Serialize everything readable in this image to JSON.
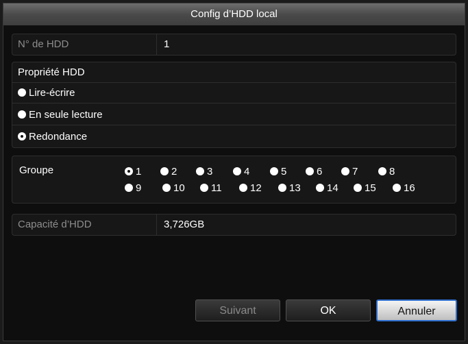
{
  "dialog": {
    "title": "Config d’HDD local"
  },
  "hdd_no": {
    "label": "N° de HDD",
    "value": "1"
  },
  "property": {
    "heading": "Propriété HDD",
    "options": [
      {
        "label": "Lire-écrire",
        "selected": false
      },
      {
        "label": "En seule lecture",
        "selected": false
      },
      {
        "label": "Redondance",
        "selected": true
      }
    ]
  },
  "group": {
    "label": "Groupe",
    "options": [
      "1",
      "2",
      "3",
      "4",
      "5",
      "6",
      "7",
      "8",
      "9",
      "10",
      "11",
      "12",
      "13",
      "14",
      "15",
      "16"
    ],
    "selected": "1"
  },
  "capacity": {
    "label": "Capacité d’HDD",
    "value": "3,726GB"
  },
  "buttons": {
    "next": "Suivant",
    "ok": "OK",
    "cancel": "Annuler"
  }
}
